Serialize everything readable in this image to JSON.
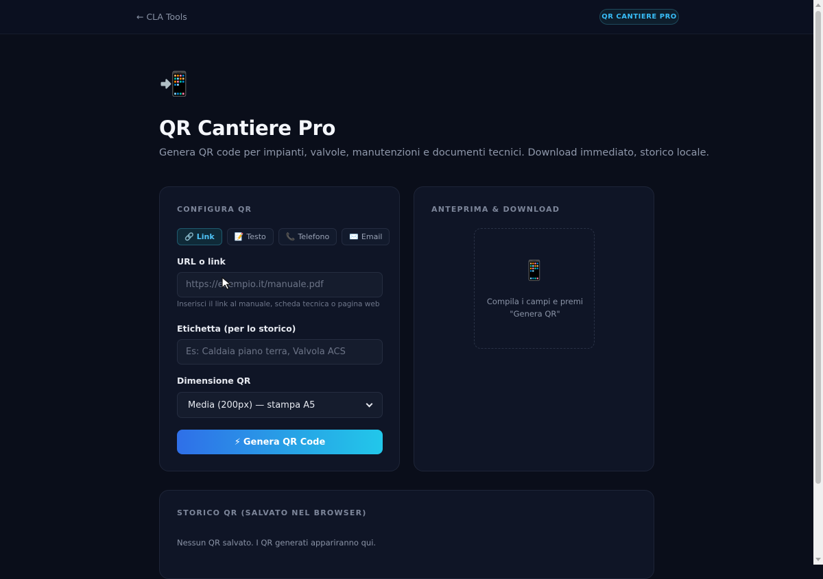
{
  "topbar": {
    "back_link": "← CLA Tools",
    "badge": "QR CANTIERE PRO"
  },
  "hero": {
    "icon": "mobile-phone-arrow-icon",
    "icon_glyph": "📲",
    "title": "QR Cantiere Pro",
    "subtitle": "Genera QR code per impianti, valvole, manutenzioni e documenti tecnici. Download immediato, storico locale."
  },
  "config": {
    "heading": "CONFIGURA QR",
    "tabs": [
      {
        "icon": "🔗",
        "label": "Link",
        "active": true
      },
      {
        "icon": "📝",
        "label": "Testo",
        "active": false
      },
      {
        "icon": "📞",
        "label": "Telefono",
        "active": false
      },
      {
        "icon": "✉️",
        "label": "Email",
        "active": false
      }
    ],
    "url_label": "URL o link",
    "url_placeholder": "https://esempio.it/manuale.pdf",
    "url_hint": "Inserisci il link al manuale, scheda tecnica o pagina web",
    "label_label": "Etichetta (per lo storico)",
    "label_placeholder": "Es: Caldaia piano terra, Valvola ACS",
    "size_label": "Dimensione QR",
    "size_selected": "Media (200px) — stampa A5",
    "generate_icon": "⚡",
    "generate_label": "Genera QR Code"
  },
  "preview": {
    "heading": "ANTEPRIMA & DOWNLOAD",
    "icon_glyph": "📱",
    "line1": "Compila i campi e premi",
    "line2": "\"Genera QR\""
  },
  "history": {
    "heading": "STORICO QR (SALVATO NEL BROWSER)",
    "empty_text": "Nessun QR salvato. I QR generati appariranno qui."
  },
  "colors": {
    "background": "#0a0e1a",
    "card": "#0f1526",
    "accent": "#38bdf8",
    "button_gradient_start": "#2f6fe8",
    "button_gradient_end": "#22c7ea"
  }
}
